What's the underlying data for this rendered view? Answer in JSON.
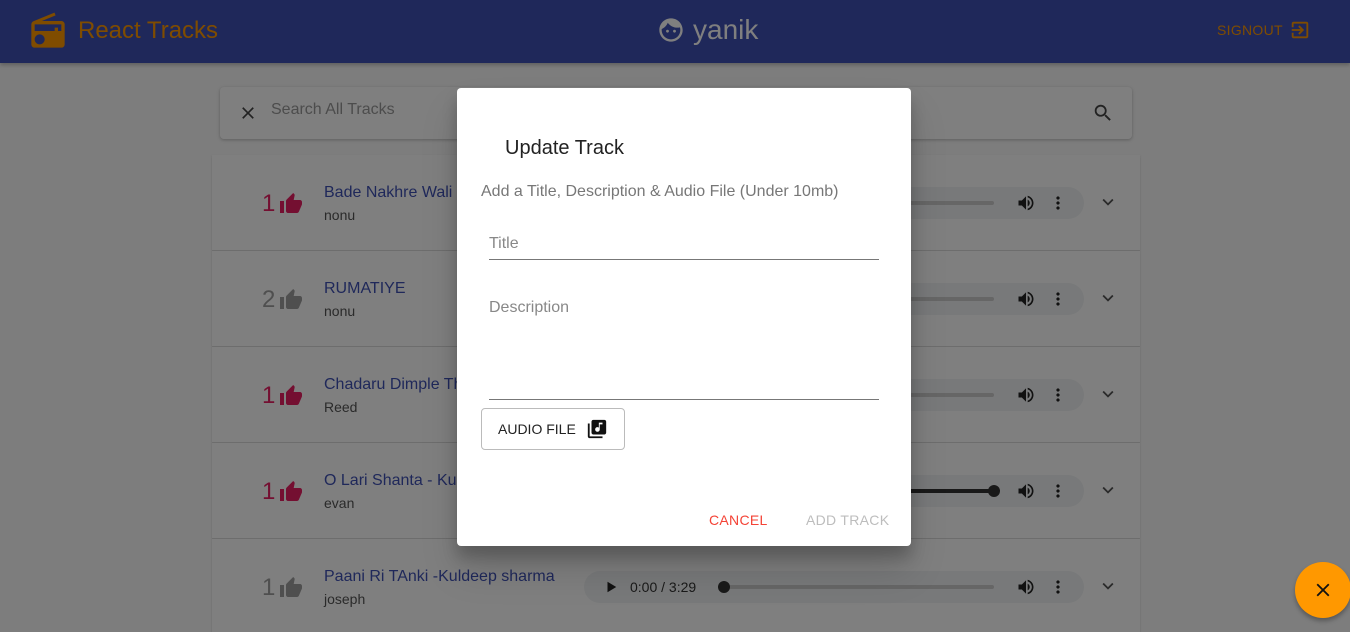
{
  "header": {
    "app_title": "React Tracks",
    "username": "yanik",
    "signout_label": "SIGNOUT"
  },
  "search": {
    "placeholder": "Search All Tracks",
    "value": ""
  },
  "tracks": [
    {
      "likes": "1",
      "liked": true,
      "title": "Bade Nakhre Wali",
      "user": "nonu",
      "progress": 0.0
    },
    {
      "likes": "2",
      "liked": false,
      "title": "RUMATIYE",
      "user": "nonu",
      "progress": 0.5
    },
    {
      "likes": "1",
      "liked": true,
      "title": "Chadaru Dimple Th",
      "user": "Reed",
      "progress": 0.0
    },
    {
      "likes": "1",
      "liked": true,
      "title": "O Lari Shanta - Ku",
      "user": "evan",
      "progress": 1.0
    },
    {
      "likes": "1",
      "liked": false,
      "title": "Paani Ri TAnki -Kuldeep sharma",
      "user": "joseph",
      "time": "0:00 / 3:29",
      "progress": 0.0
    }
  ],
  "dialog": {
    "title": "Update Track",
    "subtitle": "Add a Title, Description & Audio File (Under 10mb)",
    "title_label": "Title",
    "description_label": "Description",
    "audio_button": "AUDIO FILE",
    "cancel": "CANCEL",
    "submit": "ADD TRACK"
  },
  "colors": {
    "appbar": "#3f51b5",
    "accent": "#ff9800",
    "like": "#e91e63",
    "cancel": "#f44336"
  }
}
